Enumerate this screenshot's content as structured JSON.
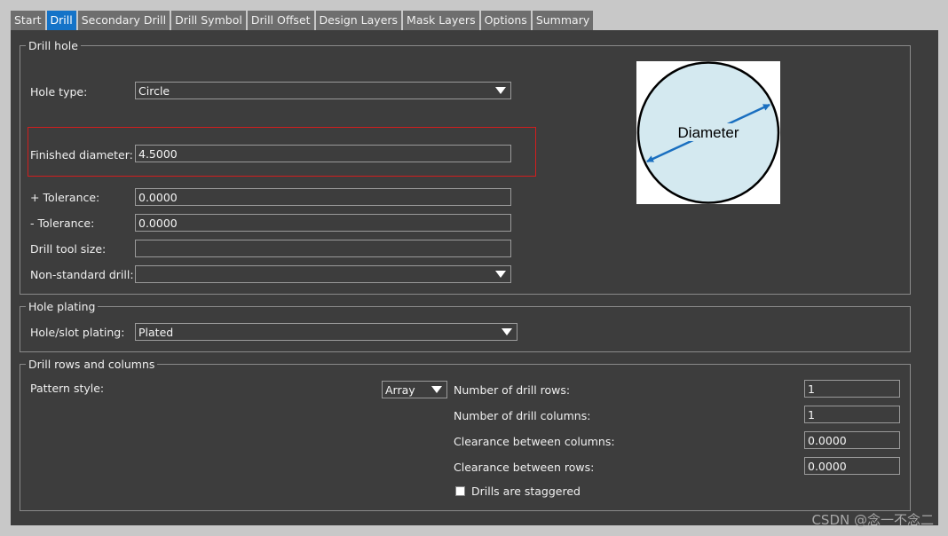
{
  "tabs": [
    "Start",
    "Drill",
    "Secondary Drill",
    "Drill Symbol",
    "Drill Offset",
    "Design Layers",
    "Mask Layers",
    "Options",
    "Summary"
  ],
  "drill_hole": {
    "title": "Drill hole",
    "hole_type_label": "Hole type:",
    "hole_type_value": "Circle",
    "finished_diameter_label": "Finished diameter:",
    "finished_diameter_value": "4.5000",
    "plus_tol_label": "+ Tolerance:",
    "plus_tol_value": "0.0000",
    "minus_tol_label": "- Tolerance:",
    "minus_tol_value": "0.0000",
    "tool_size_label": "Drill tool size:",
    "tool_size_value": "",
    "nonstd_label": "Non-standard drill:",
    "nonstd_value": ""
  },
  "diagram": {
    "label": "Diameter",
    "fill": "#d4e9f0",
    "arrow_color": "#1a6fc0"
  },
  "hole_plating": {
    "title": "Hole plating",
    "label": "Hole/slot plating:",
    "value": "Plated"
  },
  "drill_rows": {
    "title": "Drill rows and columns",
    "pattern_label": "Pattern style:",
    "pattern_value": "Array",
    "rows_label": "Number of drill rows:",
    "rows_value": "1",
    "cols_label": "Number of drill columns:",
    "cols_value": "1",
    "clear_cols_label": "Clearance between columns:",
    "clear_cols_value": "0.0000",
    "clear_rows_label": "Clearance between rows:",
    "clear_rows_value": "0.0000",
    "staggered_label": "Drills are staggered"
  },
  "watermark": "CSDN @念一不念二",
  "colors": {
    "active_tab": "#1473c8",
    "highlight": "#d21e1e",
    "panel": "#3d3d3d"
  }
}
